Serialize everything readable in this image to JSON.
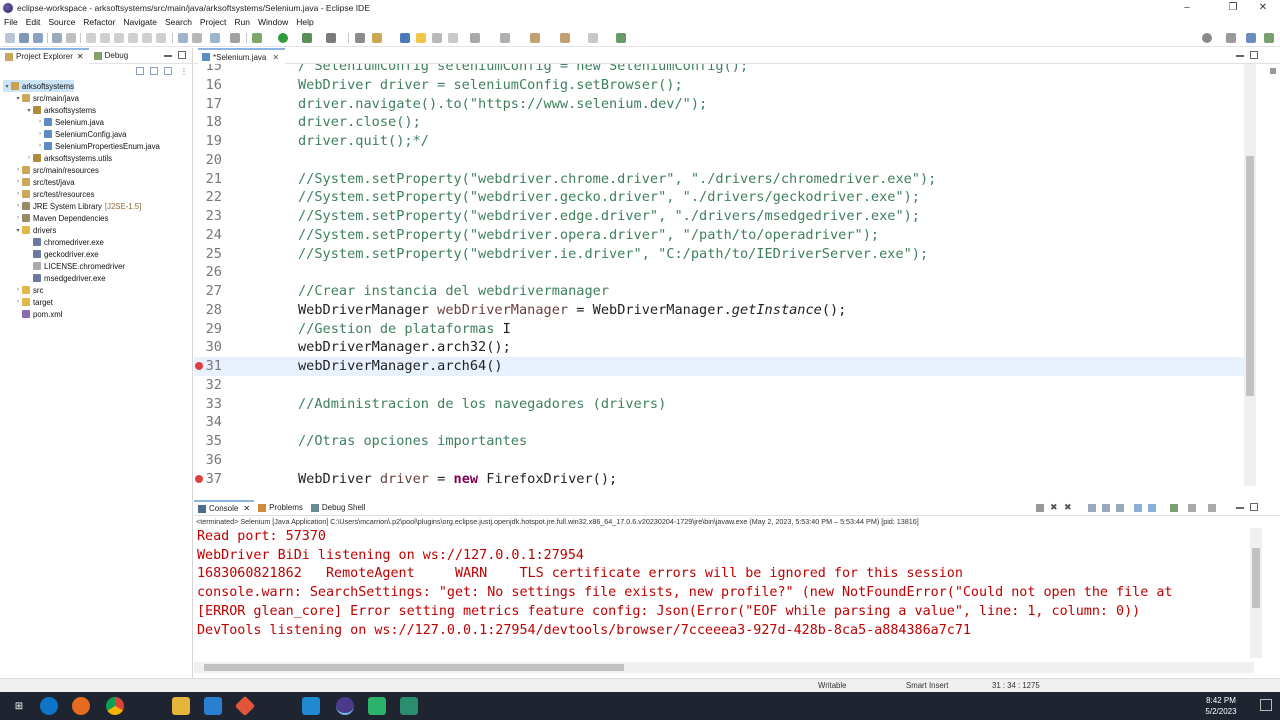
{
  "window": {
    "title": "eclipse-workspace - arksoftsystems/src/main/java/arksoftsystems/Selenium.java - Eclipse IDE",
    "controls": [
      "–",
      "❐",
      "✕"
    ]
  },
  "menu": [
    "File",
    "Edit",
    "Source",
    "Refactor",
    "Navigate",
    "Search",
    "Project",
    "Run",
    "Window",
    "Help"
  ],
  "explorer": {
    "tabs": [
      {
        "label": "Project Explorer",
        "icon": "project-explorer-icon"
      },
      {
        "label": "Debug",
        "icon": "debug-icon"
      }
    ],
    "tree": [
      {
        "label": "arksoftsystems",
        "depth": 0,
        "arrow": "▾",
        "icon": "project-icon",
        "selected": true
      },
      {
        "label": "src/main/java",
        "depth": 1,
        "arrow": "▾",
        "icon": "source-folder-icon"
      },
      {
        "label": "arksoftsystems",
        "depth": 2,
        "arrow": "▾",
        "icon": "package-icon"
      },
      {
        "label": "Selenium.java",
        "depth": 3,
        "arrow": "›",
        "icon": "java-file-icon"
      },
      {
        "label": "SeleniumConfig.java",
        "depth": 3,
        "arrow": "›",
        "icon": "java-file-icon"
      },
      {
        "label": "SeleniumPropertiesEnum.java",
        "depth": 3,
        "arrow": "›",
        "icon": "java-file-icon"
      },
      {
        "label": "arksoftsystems.utils",
        "depth": 2,
        "arrow": "›",
        "icon": "package-icon"
      },
      {
        "label": "src/main/resources",
        "depth": 1,
        "arrow": "›",
        "icon": "source-folder-icon"
      },
      {
        "label": "src/test/java",
        "depth": 1,
        "arrow": "›",
        "icon": "source-folder-icon"
      },
      {
        "label": "src/test/resources",
        "depth": 1,
        "arrow": "›",
        "icon": "source-folder-icon"
      },
      {
        "label": "JRE System Library",
        "suffix": "[J2SE-1.5]",
        "depth": 1,
        "arrow": "›",
        "icon": "library-icon"
      },
      {
        "label": "Maven Dependencies",
        "depth": 1,
        "arrow": "›",
        "icon": "library-icon"
      },
      {
        "label": "drivers",
        "depth": 1,
        "arrow": "▾",
        "icon": "folder-icon"
      },
      {
        "label": "chromedriver.exe",
        "depth": 2,
        "arrow": "",
        "icon": "exe-file-icon"
      },
      {
        "label": "geckodriver.exe",
        "depth": 2,
        "arrow": "",
        "icon": "exe-file-icon"
      },
      {
        "label": "LICENSE.chromedriver",
        "depth": 2,
        "arrow": "",
        "icon": "text-file-icon"
      },
      {
        "label": "msedgedriver.exe",
        "depth": 2,
        "arrow": "",
        "icon": "exe-file-icon"
      },
      {
        "label": "src",
        "depth": 1,
        "arrow": "›",
        "icon": "folder-icon"
      },
      {
        "label": "target",
        "depth": 1,
        "arrow": "›",
        "icon": "folder-icon"
      },
      {
        "label": "pom.xml",
        "depth": 1,
        "arrow": "",
        "icon": "xml-file-icon"
      }
    ]
  },
  "editor": {
    "tab": "*Selenium.java",
    "lines": [
      {
        "n": "15",
        "parts": [
          [
            "cm",
            "/ SeleniumConfig seleniumConfig = new SeleniumConfig();"
          ]
        ]
      },
      {
        "n": "16",
        "parts": [
          [
            "cm",
            "WebDriver driver = seleniumConfig.setBrowser();"
          ]
        ]
      },
      {
        "n": "17",
        "parts": [
          [
            "cm",
            "driver.navigate().to(\"https://www.selenium.dev/\");"
          ]
        ]
      },
      {
        "n": "18",
        "parts": [
          [
            "cm",
            "driver.close();"
          ]
        ]
      },
      {
        "n": "19",
        "parts": [
          [
            "cm",
            "driver.quit();*/"
          ]
        ]
      },
      {
        "n": "20",
        "parts": []
      },
      {
        "n": "21",
        "parts": [
          [
            "cm",
            "//System.setProperty(\"webdriver.chrome.driver\", \"./drivers/chromedriver.exe\");"
          ]
        ]
      },
      {
        "n": "22",
        "parts": [
          [
            "cm",
            "//System.setProperty(\"webdriver.gecko.driver\", \"./drivers/geckodriver.exe\");"
          ]
        ]
      },
      {
        "n": "23",
        "parts": [
          [
            "cm",
            "//System.setProperty(\"webdriver.edge.driver\", \"./drivers/msedgedriver.exe\");"
          ]
        ]
      },
      {
        "n": "24",
        "parts": [
          [
            "cm",
            "//System.setProperty(\"webdriver.opera.driver\", \"/path/to/operadriver\");"
          ]
        ]
      },
      {
        "n": "25",
        "parts": [
          [
            "cm",
            "//System.setProperty(\"webdriver.ie.driver\", \"C:/path/to/IEDriverServer.exe\");"
          ]
        ]
      },
      {
        "n": "26",
        "parts": []
      },
      {
        "n": "27",
        "parts": [
          [
            "cm",
            "//Crear instancia del webdrivermanager"
          ]
        ]
      },
      {
        "n": "28",
        "parts": [
          [
            "pl",
            "WebDriverManager "
          ],
          [
            "var",
            "webDriverManager"
          ],
          [
            "pl",
            " = WebDriverManager."
          ],
          [
            "it",
            "getInstance"
          ],
          [
            "pl",
            "();"
          ]
        ]
      },
      {
        "n": "29",
        "parts": [
          [
            "cm",
            "//Gestion de plataformas"
          ],
          [
            "pl",
            " I"
          ]
        ]
      },
      {
        "n": "30",
        "parts": [
          [
            "pl",
            "webDriverManager.arch32();"
          ]
        ]
      },
      {
        "n": "31",
        "parts": [
          [
            "pl",
            "webDriverManager.arch64()"
          ]
        ],
        "current": true,
        "error": true
      },
      {
        "n": "32",
        "parts": []
      },
      {
        "n": "33",
        "parts": [
          [
            "cm",
            "//Administracion de los navegadores (drivers)"
          ]
        ]
      },
      {
        "n": "34",
        "parts": []
      },
      {
        "n": "35",
        "parts": [
          [
            "cm",
            "//Otras opciones importantes"
          ]
        ]
      },
      {
        "n": "36",
        "parts": []
      },
      {
        "n": "37",
        "parts": [
          [
            "pl",
            "WebDriver "
          ],
          [
            "var",
            "driver"
          ],
          [
            "pl",
            " = "
          ],
          [
            "kw",
            "new"
          ],
          [
            "pl",
            " FirefoxDriver();"
          ]
        ],
        "error": true
      }
    ]
  },
  "console": {
    "tabs": [
      {
        "label": "Console",
        "icon": "console-icon"
      },
      {
        "label": "Problems",
        "icon": "problems-icon"
      },
      {
        "label": "Debug Shell",
        "icon": "debug-shell-icon"
      }
    ],
    "terminated": "<terminated> Selenium [Java Application] C:\\Users\\mcarrion\\.p2\\pool\\plugins\\org.eclipse.justj.openjdk.hotspot.jre.full.win32.x86_64_17.0.6.v20230204-1729\\jre\\bin\\javaw.exe  (May 2, 2023, 5:53:40 PM – 5:53:44 PM) [pid: 13816]",
    "output": [
      "Read port: 57370",
      "WebDriver BiDi listening on ws://127.0.0.1:27954",
      "1683060821862   RemoteAgent     WARN    TLS certificate errors will be ignored for this session",
      "console.warn: SearchSettings: \"get: No settings file exists, new profile?\" (new NotFoundError(\"Could not open the file at",
      "[ERROR glean_core] Error setting metrics feature config: Json(Error(\"EOF while parsing a value\", line: 1, column: 0))",
      "DevTools listening on ws://127.0.0.1:27954/devtools/browser/7cceeea3-927d-428b-8ca5-a884386a7c71"
    ]
  },
  "status": {
    "writable": "Writable",
    "insert_mode": "Smart Insert",
    "position": "31 : 34 : 1275"
  },
  "taskbar": {
    "time": "8:42 PM",
    "date": "5/2/2023",
    "apps": [
      "windows-start-icon",
      "edge-icon",
      "firefox-icon",
      "chrome-icon",
      "file-explorer-icon",
      "mail-icon",
      "git-icon",
      "vscode-icon",
      "eclipse-icon",
      "terminal-icon",
      "app-icon"
    ]
  },
  "colors": {
    "comment": "#3f7f5f",
    "keyword": "#7f0055",
    "console_error": "#c00000",
    "current_line": "#e8f2fe",
    "tab_accent": "#8bb4e0"
  }
}
